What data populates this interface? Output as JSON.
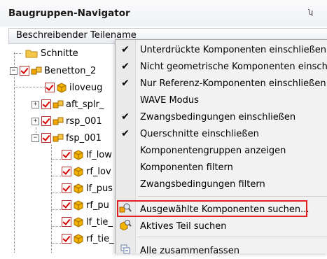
{
  "window": {
    "title": "Baugruppen-Navigator",
    "pin_glyph": "ʮ"
  },
  "column_header": "Beschreibender Teilename",
  "tree": {
    "nodes": [
      {
        "label": "Schnitte"
      },
      {
        "label": "Benetton_2"
      },
      {
        "label": "iloveug"
      },
      {
        "label": "aft_splr_"
      },
      {
        "label": "rsp_001"
      },
      {
        "label": "fsp_001"
      },
      {
        "label": "lf_low"
      },
      {
        "label": "rf_lov"
      },
      {
        "label": "lf_pus"
      },
      {
        "label": "rf_pu"
      },
      {
        "label": "lf_tie_"
      },
      {
        "label": "rf_tie_"
      }
    ]
  },
  "context_menu": {
    "items": [
      {
        "label": "Unterdrückte Komponenten einschließen",
        "checked": true
      },
      {
        "label": "Nicht geometrische Komponenten einsch",
        "checked": true
      },
      {
        "label": "Nur Referenz-Komponenten einschließen",
        "checked": true
      },
      {
        "label": "WAVE Modus",
        "checked": false
      },
      {
        "label": "Zwangsbedingungen einschließen",
        "checked": true
      },
      {
        "label": "Querschnitte einschließen",
        "checked": true
      },
      {
        "label": "Komponentengruppen anzeigen",
        "checked": false
      },
      {
        "label": "Komponenten filtern",
        "checked": false
      },
      {
        "label": "Zwangsbedingungen filtern",
        "checked": false
      },
      {
        "label": "Ausgewählte Komponenten suchen...",
        "icon": "find-selected-icon",
        "highlighted": true
      },
      {
        "label": "Aktives Teil suchen",
        "icon": "find-active-part-icon"
      },
      {
        "label": "Alle zusammenfassen",
        "icon": "collapse-all-icon"
      }
    ]
  },
  "colors": {
    "highlight_border": "#e02020",
    "check_red": "#d60000",
    "cube_orange": "#f2a400"
  }
}
